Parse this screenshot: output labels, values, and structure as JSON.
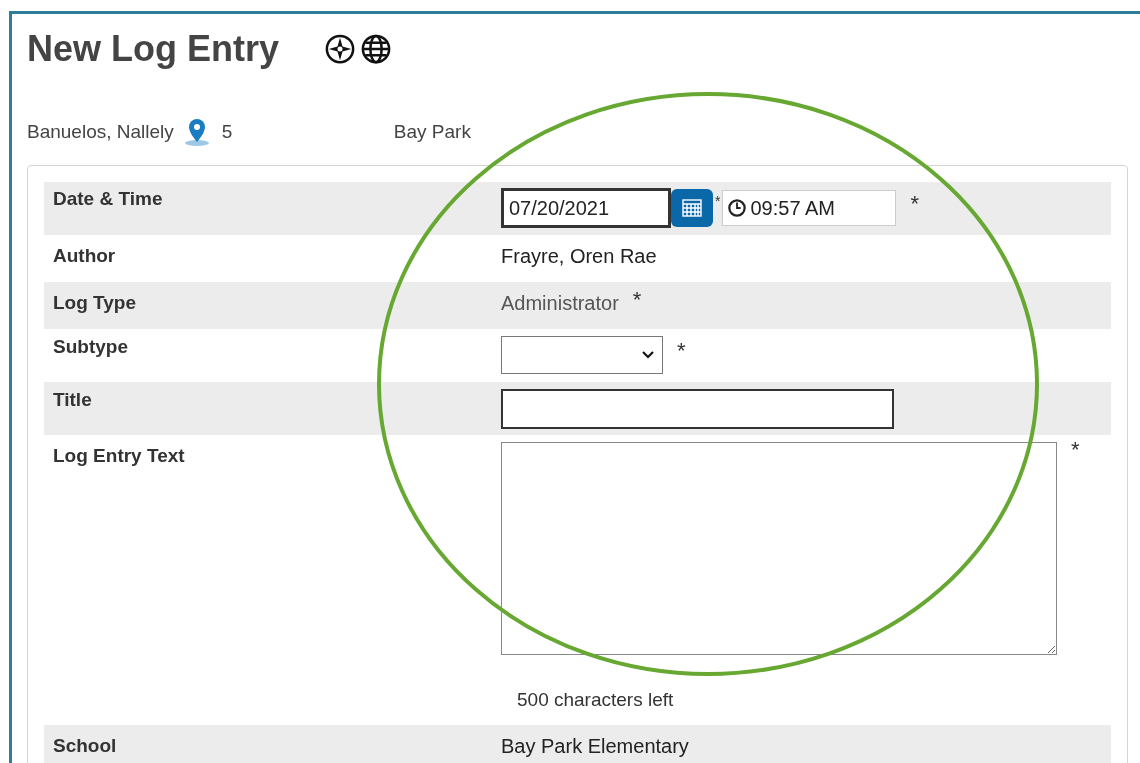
{
  "title": "New Log Entry",
  "student": {
    "name": "Banuelos, Nallely",
    "grade": "5",
    "school": "Bay Park"
  },
  "rows": [
    {
      "label": "Date & Time",
      "kind": "datetime",
      "date": "07/20/2021",
      "date_mark": "*",
      "time": "09:57 AM",
      "mark": "*"
    },
    {
      "label": "Author",
      "kind": "text",
      "value": "Frayre, Oren Rae"
    },
    {
      "label": "Log Type",
      "kind": "text",
      "value": "Administrator",
      "mark": "*"
    },
    {
      "label": "Subtype",
      "kind": "select",
      "mark": "*"
    },
    {
      "label": "Title",
      "kind": "input"
    },
    {
      "label": "Log Entry Text",
      "kind": "textarea",
      "mark": "*",
      "counter": "500 characters left"
    },
    {
      "label": "School",
      "kind": "text",
      "value": "Bay Park Elementary"
    }
  ]
}
